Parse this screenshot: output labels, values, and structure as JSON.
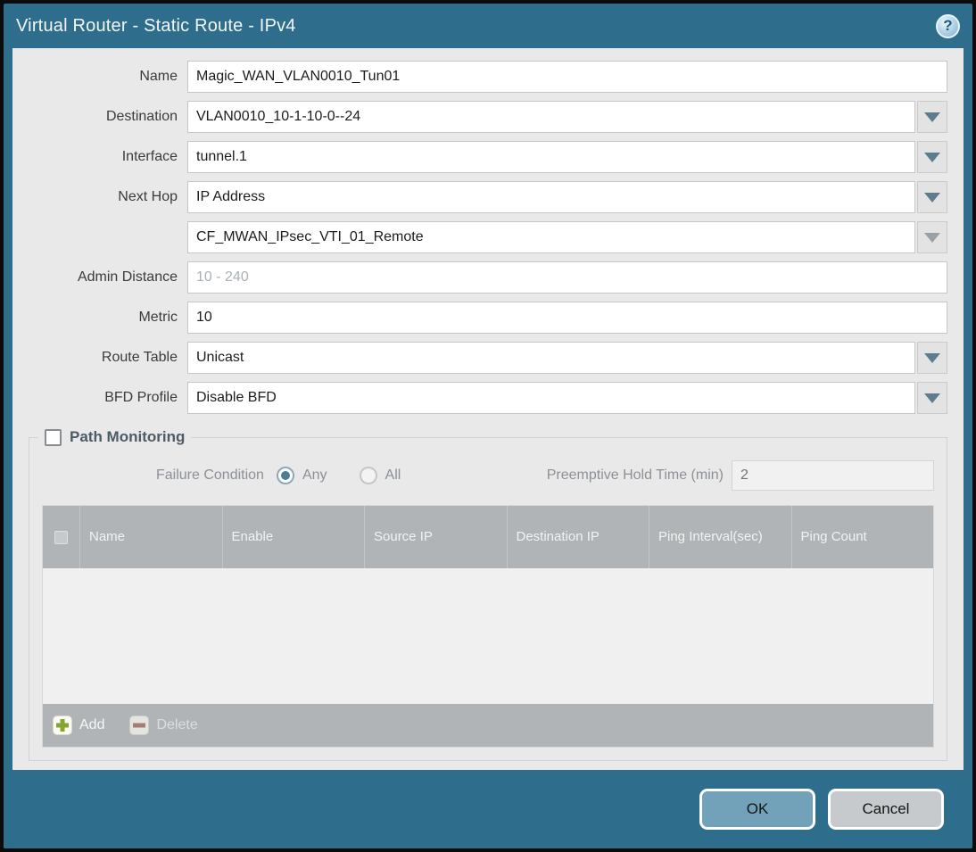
{
  "header": {
    "title": "Virtual Router - Static Route - IPv4",
    "help_icon": "?"
  },
  "form": {
    "name": {
      "label": "Name",
      "value": "Magic_WAN_VLAN0010_Tun01"
    },
    "destination": {
      "label": "Destination",
      "value": "VLAN0010_10-1-10-0--24"
    },
    "interface": {
      "label": "Interface",
      "value": "tunnel.1"
    },
    "next_hop": {
      "label": "Next Hop",
      "value": "IP Address"
    },
    "next_hop_address": {
      "value": "CF_MWAN_IPsec_VTI_01_Remote"
    },
    "admin_distance": {
      "label": "Admin Distance",
      "placeholder": "10 - 240",
      "value": ""
    },
    "metric": {
      "label": "Metric",
      "value": "10"
    },
    "route_table": {
      "label": "Route Table",
      "value": "Unicast"
    },
    "bfd_profile": {
      "label": "BFD Profile",
      "value": "Disable BFD"
    }
  },
  "path_monitoring": {
    "title": "Path Monitoring",
    "enabled": false,
    "failure_condition_label": "Failure Condition",
    "failure_options": {
      "any": "Any",
      "all": "All"
    },
    "failure_selected": "Any",
    "preemptive_label": "Preemptive Hold Time (min)",
    "preemptive_value": "2",
    "table": {
      "columns": [
        "Name",
        "Enable",
        "Source IP",
        "Destination IP",
        "Ping Interval(sec)",
        "Ping Count"
      ],
      "rows": []
    },
    "add_label": "Add",
    "delete_label": "Delete"
  },
  "footer": {
    "ok_label": "OK",
    "cancel_label": "Cancel"
  },
  "colors": {
    "titlebar": "#2e6d8c",
    "accent_teal": "#4d7e95",
    "ok_button": "#72a2ba",
    "cancel_button": "#c7cacc",
    "table_header": "#b0b4b7",
    "add_icon_green": "#85a433",
    "delete_icon_red": "#a2655c"
  }
}
